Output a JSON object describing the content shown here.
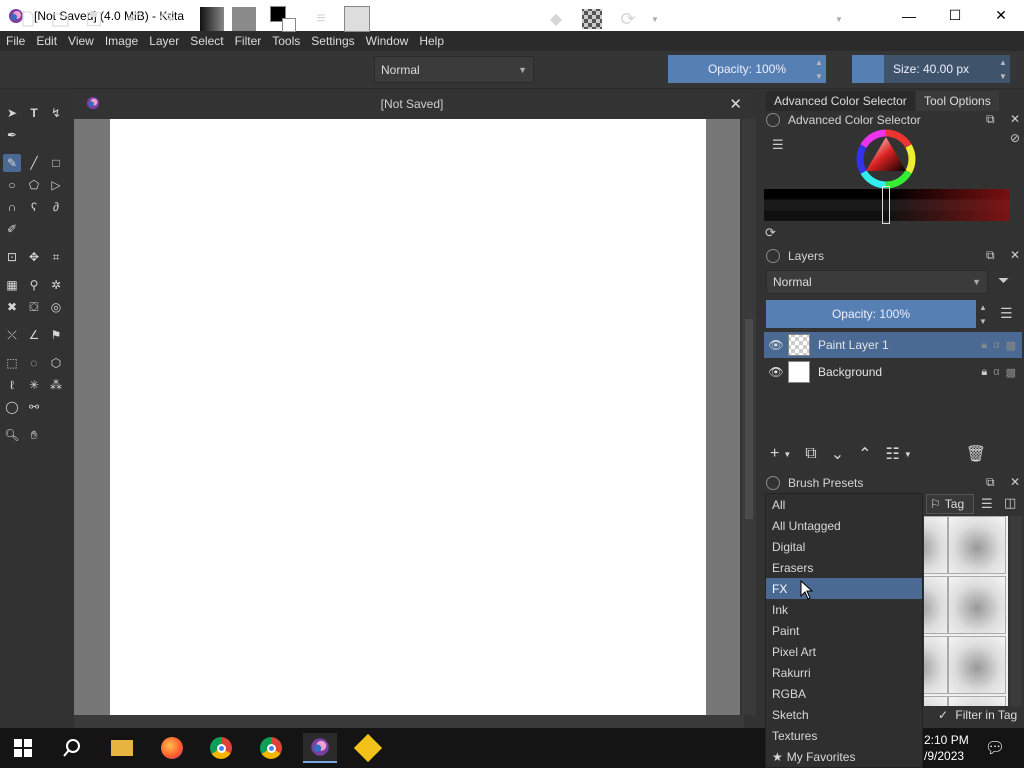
{
  "window": {
    "title": "[Not Saved]  (4.0 MiB)  - Krita",
    "minimize": "—",
    "maximize": "☐",
    "close": "✕"
  },
  "menu": [
    "File",
    "Edit",
    "View",
    "Image",
    "Layer",
    "Select",
    "Filter",
    "Tools",
    "Settings",
    "Window",
    "Help"
  ],
  "toolbar": {
    "blend_mode": "Normal",
    "opacity_label": "Opacity: 100%",
    "size_label": "Size: 40.00 px"
  },
  "canvas": {
    "tab_title": "[Not Saved]",
    "close": "✕"
  },
  "docker_tabs": {
    "color_selector": "Advanced Color Selector",
    "tool_options": "Tool Options"
  },
  "color_panel": {
    "title": "Advanced Color Selector"
  },
  "layers_panel": {
    "title": "Layers",
    "blend_mode": "Normal",
    "opacity_label": "Opacity:  100%",
    "layers": [
      {
        "name": "Paint Layer 1",
        "selected": true
      },
      {
        "name": "Background",
        "selected": false
      }
    ]
  },
  "brush_presets": {
    "title": "Brush Presets",
    "tag_label": "Tag",
    "filter_in_tag": "Filter in Tag",
    "tags": [
      "All",
      "All Untagged",
      "Digital",
      "Erasers",
      "FX",
      "Ink",
      "Paint",
      "Pixel Art",
      "Rakurri",
      "RGBA",
      "Sketch",
      "Textures",
      "My Favorites"
    ],
    "hovered_tag": "FX"
  },
  "taskbar": {
    "time": "2:10 PM",
    "date": "/9/2023"
  },
  "colors": {
    "accent": "#4a6a94",
    "slider": "#5680b3",
    "canvas": "#ffffff",
    "background": "#323232"
  }
}
